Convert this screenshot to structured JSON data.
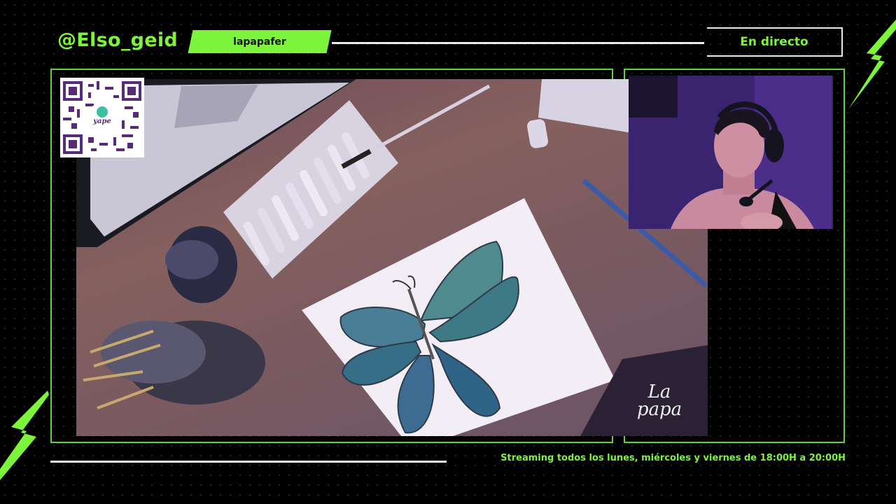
{
  "header": {
    "handle": "@Elso_geid",
    "tag": "lapapafer",
    "live_badge": "En directo"
  },
  "overlay": {
    "qr_brand": "yape",
    "signature_line1": "La",
    "signature_line2": "papa"
  },
  "footer": {
    "schedule": "Streaming todos los lunes, miércoles y viernes de 18:00H a 20:00H"
  },
  "colors": {
    "accent": "#7cf43c",
    "frame": "#5fd33a",
    "background": "#000000"
  }
}
